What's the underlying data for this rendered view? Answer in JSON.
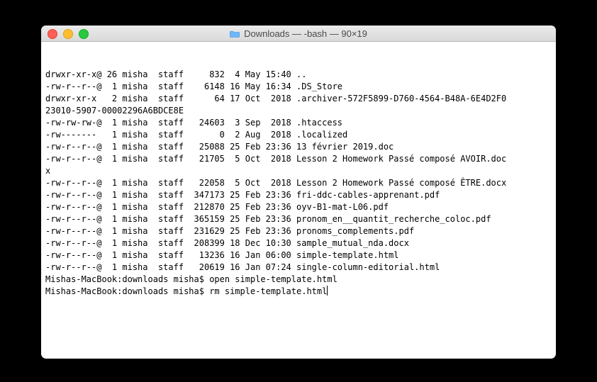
{
  "window": {
    "title": "Downloads — -bash — 90×19"
  },
  "terminal": {
    "lines": [
      "drwxr-xr-x@ 26 misha  staff     832  4 May 15:40 ..",
      "-rw-r--r--@  1 misha  staff    6148 16 May 16:34 .DS_Store",
      "drwxr-xr-x   2 misha  staff      64 17 Oct  2018 .archiver-572F5899-D760-4564-B48A-6E4D2F0",
      "23010-5907-00002296A6BDCE8E",
      "-rw-rw-rw-@  1 misha  staff   24603  3 Sep  2018 .htaccess",
      "-rw-------   1 misha  staff       0  2 Aug  2018 .localized",
      "-rw-r--r--@  1 misha  staff   25088 25 Feb 23:36 13 février 2019.doc",
      "-rw-r--r--@  1 misha  staff   21705  5 Oct  2018 Lesson 2 Homework Passé composé AVOIR.doc",
      "x",
      "-rw-r--r--@  1 misha  staff   22058  5 Oct  2018 Lesson 2 Homework Passé composé ÊTRE.docx",
      "-rw-r--r--@  1 misha  staff  347173 25 Feb 23:36 fri-ddc-cables-apprenant.pdf",
      "-rw-r--r--@  1 misha  staff  212870 25 Feb 23:36 oyv-B1-mat-L06.pdf",
      "-rw-r--r--@  1 misha  staff  365159 25 Feb 23:36 pronom_en__quantit_recherche_coloc.pdf",
      "-rw-r--r--@  1 misha  staff  231629 25 Feb 23:36 pronoms_complements.pdf",
      "-rw-r--r--@  1 misha  staff  208399 18 Dec 10:30 sample_mutual_nda.docx",
      "-rw-r--r--@  1 misha  staff   13236 16 Jan 06:00 simple-template.html",
      "-rw-r--r--@  1 misha  staff   20619 16 Jan 07:24 single-column-editorial.html",
      "Mishas-MacBook:downloads misha$ open simple-template.html",
      "Mishas-MacBook:downloads misha$ rm simple-template.html"
    ]
  }
}
